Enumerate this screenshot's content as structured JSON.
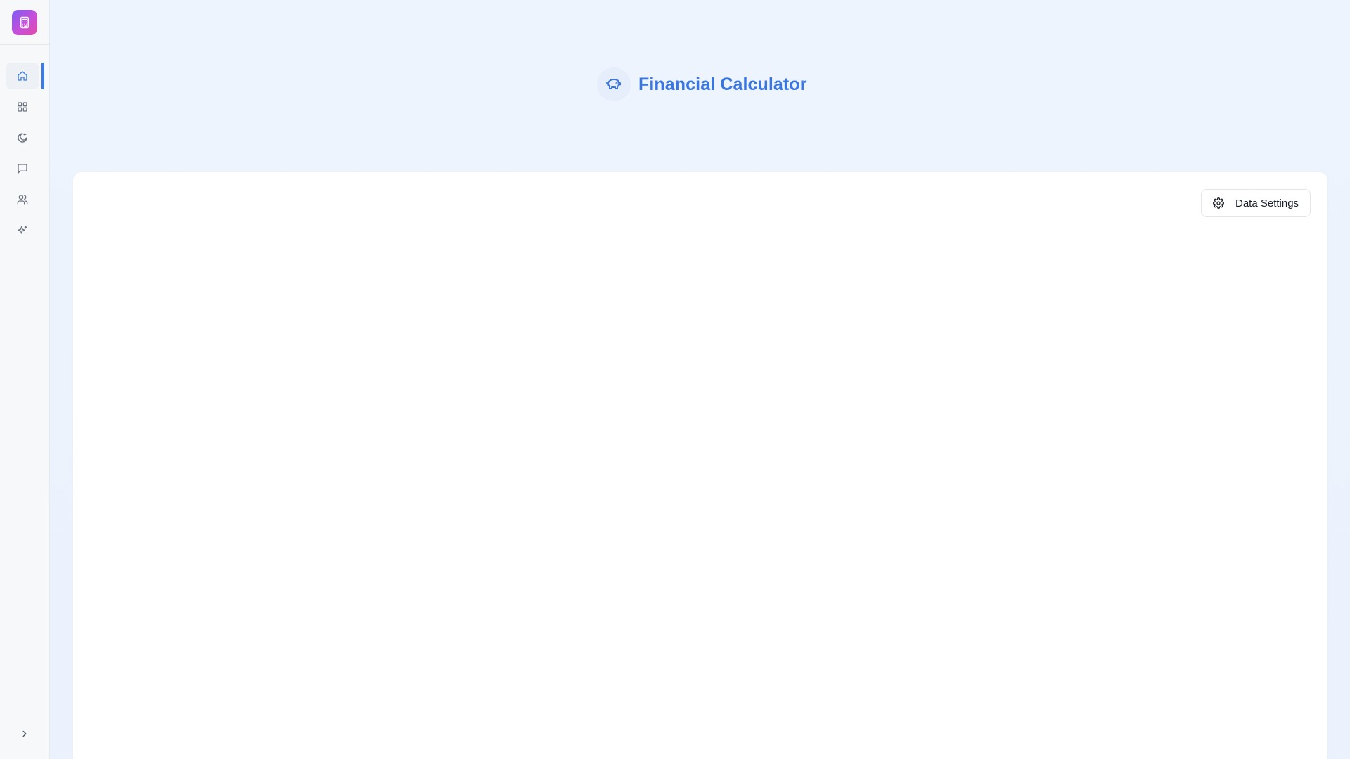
{
  "app": {
    "title": "Financial Calculator"
  },
  "sidebar": {
    "items": [
      {
        "id": "home",
        "icon": "home-icon",
        "active": true
      },
      {
        "id": "apps",
        "icon": "grid-icon",
        "active": false
      },
      {
        "id": "theme",
        "icon": "moon-sparkle-icon",
        "active": false
      },
      {
        "id": "messages",
        "icon": "message-icon",
        "active": false
      },
      {
        "id": "users",
        "icon": "users-icon",
        "active": false
      },
      {
        "id": "ai",
        "icon": "sparkles-icon",
        "active": false
      }
    ],
    "expand_icon": "chevron-right-icon"
  },
  "toolbar": {
    "settings_label": "Data Settings"
  },
  "colors": {
    "accent": "#3b7be8",
    "title": "#3a76e0"
  }
}
